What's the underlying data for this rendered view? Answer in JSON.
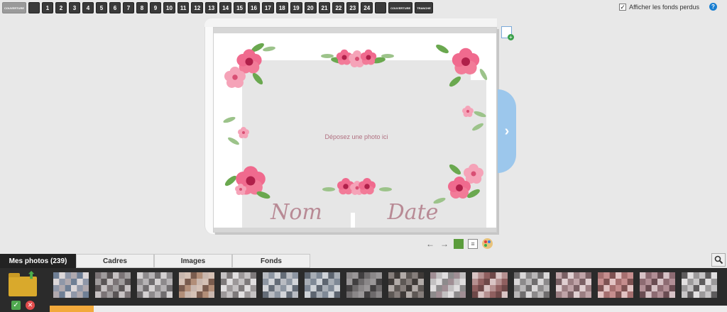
{
  "pagebar": {
    "cover_front": "COUVERTURE",
    "pages": [
      "1",
      "2",
      "3",
      "4",
      "5",
      "6",
      "7",
      "8",
      "9",
      "10",
      "11",
      "12",
      "13",
      "14",
      "15",
      "16",
      "17",
      "18",
      "19",
      "20",
      "21",
      "22",
      "23",
      "24"
    ],
    "cover_back": "COUVERTURE",
    "spine": "TRANCHE"
  },
  "options": {
    "show_bleed_label": "Afficher les fonds perdus",
    "show_bleed_checked": true,
    "help_label": "?"
  },
  "page": {
    "drop_photo_text": "Déposez une photo ici",
    "name_text": "Nom",
    "date_text": "Date"
  },
  "nav": {
    "next_glyph": "›",
    "prev_arrow": "←",
    "next_arrow": "→"
  },
  "tabs": [
    "Mes photos (239)",
    "Cadres",
    "Images",
    "Fonds"
  ],
  "panel": {
    "ok_glyph": "✓",
    "cancel_glyph": "✕",
    "upload_glyph": "⬆",
    "thumbnail_palettes": [
      [
        "#6f7f95",
        "#b0a9ae",
        "#8f97a8",
        "#dcd7d9"
      ],
      [
        "#a09c9d",
        "#7b7476",
        "#c7c2c3",
        "#5a5556"
      ],
      [
        "#b6b3b5",
        "#8d8a8c",
        "#d4d1d2",
        "#706d6f"
      ],
      [
        "#b28e78",
        "#7a5c4e",
        "#d5c1b5",
        "#c9b7ae"
      ],
      [
        "#c5c2c3",
        "#9c9899",
        "#e1dfe0",
        "#7e7a7b"
      ],
      [
        "#8d96a2",
        "#b9bcc2",
        "#646c77",
        "#d3d5d9"
      ],
      [
        "#7f8996",
        "#a8aeb6",
        "#5d6570",
        "#cfd3d8"
      ],
      [
        "#6d6a6b",
        "#413f40",
        "#9a9798",
        "#8a8788"
      ],
      [
        "#867e7b",
        "#5e5855",
        "#b2aba8",
        "#3f3a38"
      ],
      [
        "#c2c0c1",
        "#a08e94",
        "#8d8b8c",
        "#e0dedf"
      ],
      [
        "#8f5f5f",
        "#b59090",
        "#d9c4c4",
        "#6e4848"
      ],
      [
        "#b9b7b8",
        "#8c8a8b",
        "#dad8d9",
        "#6f6d6e"
      ],
      [
        "#c0a4a8",
        "#9b7e82",
        "#e0cfd1",
        "#7a6064"
      ],
      [
        "#c58e8e",
        "#a56f6f",
        "#e2c3c3",
        "#7e5252"
      ],
      [
        "#b18e95",
        "#8d6b72",
        "#d7c2c6",
        "#6a4c52"
      ],
      [
        "#c7c5c6",
        "#9c9a9b",
        "#e2e0e1",
        "#5e5c5d"
      ]
    ],
    "progress_fraction": 0.065
  },
  "colors": {
    "accent_blue": "#9cc7ec",
    "frame_gray": "#e6e6e6",
    "progress_orange": "#f2a93b",
    "dark_panel": "#2b2b2b"
  }
}
